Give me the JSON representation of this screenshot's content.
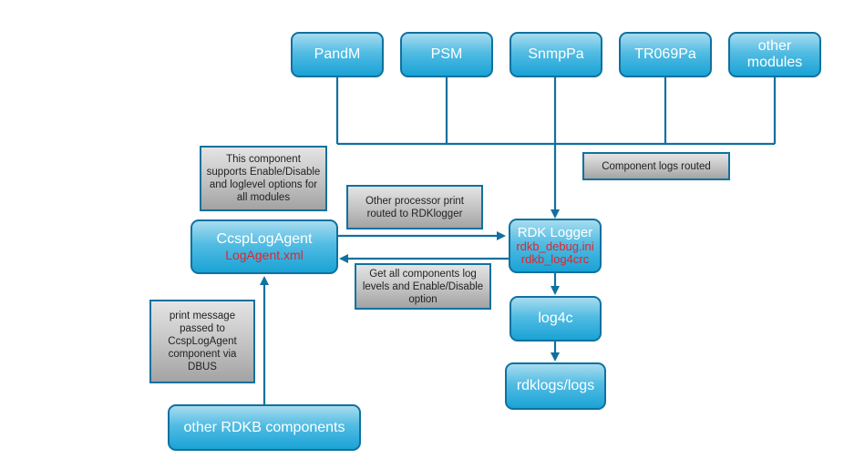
{
  "diagram": {
    "modules": [
      {
        "id": "pandm",
        "label": "PandM"
      },
      {
        "id": "psm",
        "label": "PSM"
      },
      {
        "id": "snmppa",
        "label": "SnmpPa"
      },
      {
        "id": "tr069pa",
        "label": "TR069Pa"
      },
      {
        "id": "other-modules",
        "label": "other\nmodules"
      }
    ],
    "ccsp_log_agent": {
      "title": "CcspLogAgent",
      "file": "LogAgent.xml"
    },
    "rdk_logger": {
      "title": "RDK Logger",
      "files": [
        "rdkb_debug.ini",
        "rdkb_log4crc"
      ]
    },
    "log4c": {
      "label": "log4c"
    },
    "rdklogs": {
      "label": "rdklogs/logs"
    },
    "other_rdkb": {
      "label": "other RDKB components"
    },
    "notes": {
      "component_support": "This component supports Enable/Disable and loglevel options for all modules",
      "other_processor": "Other processor print routed to RDKlogger",
      "component_logs_routed": "Component logs routed",
      "get_all_components": "Get all components log levels and Enable/Disable option",
      "print_message": "print message passed to CcspLogAgent component via DBUS"
    },
    "colors": {
      "accent_line": "#10719f",
      "file_text": "#e0252b"
    }
  }
}
